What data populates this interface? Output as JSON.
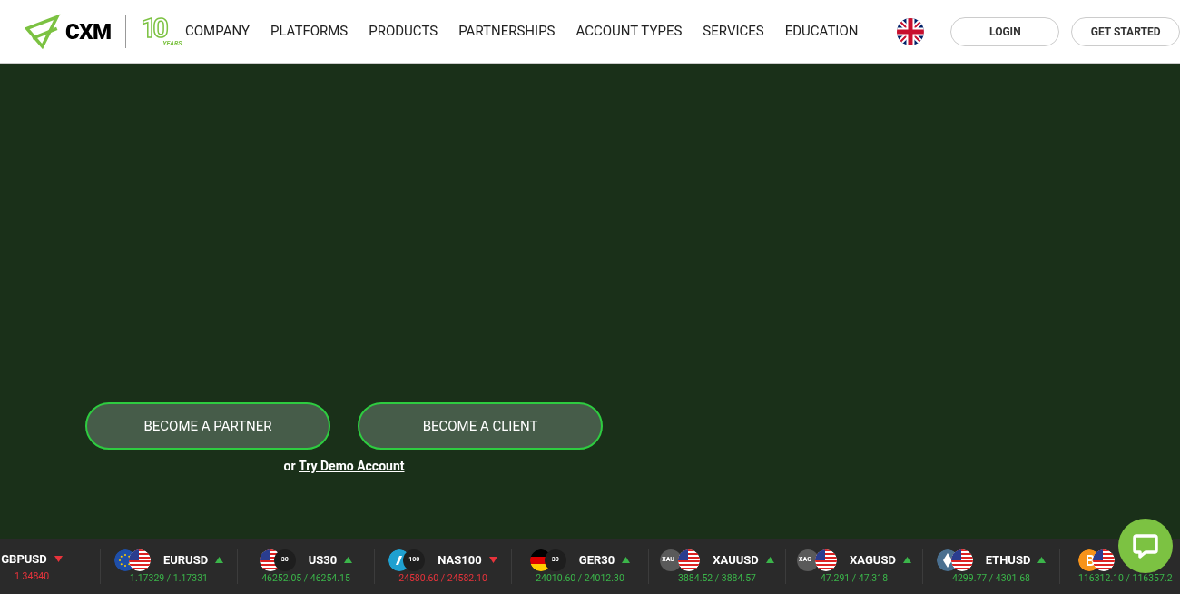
{
  "header": {
    "logo": "CXM",
    "anniversary": {
      "number": "10",
      "label": "YEARS"
    },
    "nav": [
      "COMPANY",
      "PLATFORMS",
      "PRODUCTS",
      "PARTNERSHIPS",
      "ACCOUNT TYPES",
      "SERVICES",
      "EDUCATION"
    ],
    "login": "LOGIN",
    "get_started": "GET STARTED"
  },
  "hero": {
    "buttons": [
      "BECOME A PARTNER",
      "BECOME A CLIENT"
    ],
    "or": "or",
    "demo_link": "Try Demo Account"
  },
  "ticker": [
    {
      "symbol": "GBPUSD",
      "rising": false,
      "price": "1.34840"
    },
    {
      "symbol": "EURUSD",
      "rising": true,
      "price": "1.17329 / 1.17331",
      "icons": [
        {
          "kind": "eu"
        },
        {
          "kind": "us"
        }
      ]
    },
    {
      "symbol": "US30",
      "rising": true,
      "price": "46252.05 / 46254.15",
      "icons": [
        {
          "kind": "us"
        },
        {
          "kind": "badge",
          "label": "30"
        }
      ]
    },
    {
      "symbol": "NAS100",
      "rising": false,
      "price": "24580.60 / 24582.10",
      "icons": [
        {
          "kind": "nasdaq"
        },
        {
          "kind": "badge",
          "label": "100"
        }
      ]
    },
    {
      "symbol": "GER30",
      "rising": true,
      "price": "24010.60 / 24012.30",
      "icons": [
        {
          "kind": "de"
        },
        {
          "kind": "badge",
          "label": "30"
        }
      ]
    },
    {
      "symbol": "XAUUSD",
      "rising": true,
      "price": "3884.52 / 3884.57",
      "icons": [
        {
          "kind": "metal",
          "label": "XAU"
        },
        {
          "kind": "us"
        }
      ]
    },
    {
      "symbol": "XAGUSD",
      "rising": true,
      "price": "47.291 / 47.318",
      "icons": [
        {
          "kind": "metal",
          "label": "XAG"
        },
        {
          "kind": "us"
        }
      ]
    },
    {
      "symbol": "ETHUSD",
      "rising": true,
      "price": "4299.77 / 4301.68",
      "icons": [
        {
          "kind": "eth"
        },
        {
          "kind": "us"
        }
      ]
    },
    {
      "rising": true,
      "price": "116312.10 / 116357.2",
      "icons": [
        {
          "kind": "btc"
        },
        {
          "kind": "us"
        }
      ]
    }
  ]
}
